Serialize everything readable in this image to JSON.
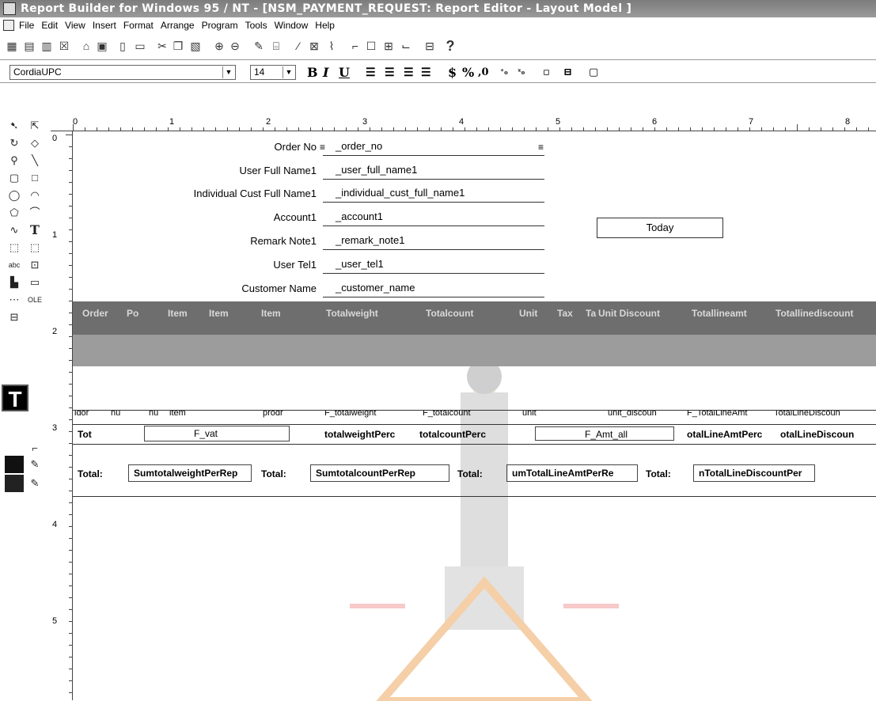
{
  "window": {
    "title": "Report Builder for Windows 95 / NT - [NSM_PAYMENT_REQUEST: Report Editor - Layout Model ]"
  },
  "menu": [
    "File",
    "Edit",
    "View",
    "Insert",
    "Format",
    "Arrange",
    "Program",
    "Tools",
    "Window",
    "Help"
  ],
  "toolbar": {
    "font_name": "CordiaUPC",
    "font_size": "14",
    "bold": "B",
    "italic": "I",
    "underline": "U",
    "currency": "$",
    "percent": "%",
    "comma": ",0",
    "help": "?"
  },
  "rulers": {
    "horizontal": [
      "0",
      "1",
      "2",
      "3",
      "4",
      "5",
      "6",
      "7",
      "8"
    ],
    "vertical": [
      "0",
      "1",
      "2",
      "3",
      "4",
      "5"
    ]
  },
  "header_fields": [
    {
      "label": "Order No",
      "field": "_order_no"
    },
    {
      "label": "User Full Name1",
      "field": "_user_full_name1"
    },
    {
      "label": "Individual Cust Full Name1",
      "field": "_individual_cust_full_name1"
    },
    {
      "label": "Account1",
      "field": "_account1"
    },
    {
      "label": "Remark Note1",
      "field": "_remark_note1"
    },
    {
      "label": "User Tel1",
      "field": "_user_tel1"
    },
    {
      "label": "Customer Name",
      "field": "_customer_name"
    }
  ],
  "today_label": "Today",
  "column_headers": [
    "Order",
    "Po",
    "Item",
    "Item",
    "Item",
    "Totalweight",
    "Totalcount",
    "Unit",
    "Tax",
    "Ta",
    "Unit Discount",
    "Totallineamt",
    "Totallinediscount"
  ],
  "repeat_fields": [
    "idor",
    "nu",
    "nu",
    "item",
    "",
    "prodr",
    "F_totalweight",
    "F_totalcount",
    "unit",
    "",
    "unit_discoun",
    "F_TotalLineAmt",
    "TotalLineDiscoun"
  ],
  "total_row": {
    "label": "Tot",
    "vat": "F_vat",
    "weight_pct": "totalweightPerc",
    "count_pct": "totalcountPerc",
    "amt_all": "F_Amt_all",
    "line_amt_pct": "otalLineAmtPerc",
    "line_disc_pct": "otalLineDiscoun"
  },
  "sum_row": [
    {
      "label": "Total:",
      "field": "SumtotalweightPerRep"
    },
    {
      "label": "Total:",
      "field": "SumtotalcountPerRep"
    },
    {
      "label": "Total:",
      "field": "umTotalLineAmtPerRe"
    },
    {
      "label": "Total:",
      "field": "nTotalLineDiscountPer"
    }
  ],
  "colors": {
    "titlebar": "#8a8a8a",
    "header_band": "#6e6e6e",
    "grey_band": "#9c9c9c",
    "watermark": "#e8b860"
  }
}
